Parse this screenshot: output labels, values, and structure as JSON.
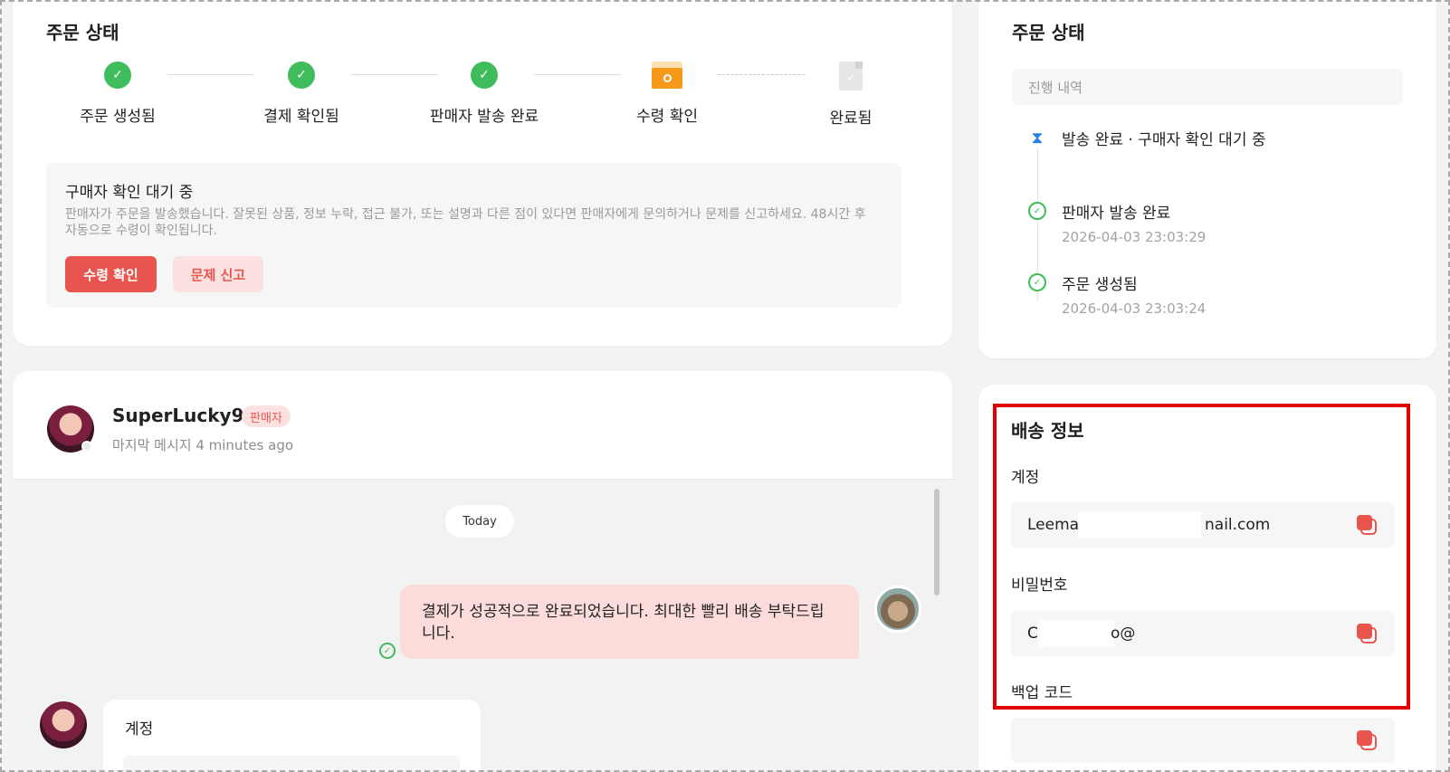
{
  "order_status": {
    "title": "주문 상태",
    "steps": [
      {
        "label": "주문 생성됨",
        "state": "done"
      },
      {
        "label": "결제 확인됨",
        "state": "done"
      },
      {
        "label": "판매자 발송 완료",
        "state": "done"
      },
      {
        "label": "수령 확인",
        "state": "current"
      },
      {
        "label": "완료됨",
        "state": "pending"
      }
    ],
    "notice": {
      "title": "구매자 확인 대기 중",
      "description": "판매자가 주문을 발송했습니다. 잘못된 상품, 정보 누락, 접근 불가, 또는 설명과 다른 점이 있다면 판매자에게 문의하거나 문제를 신고하세요. 48시간 후 자동으로 수령이 확인됩니다.",
      "confirm_button": "수령 확인",
      "report_button": "문제 신고"
    }
  },
  "chat": {
    "seller_name": "SuperLucky99",
    "seller_badge": "판매자",
    "last_message": "마지막 메시지 4 minutes ago",
    "date_divider": "Today",
    "messages": [
      {
        "direction": "out",
        "text": "결제가 성공적으로 완료되었습니다. 최대한 빨리 배송 부탁드립니다.",
        "read": true
      },
      {
        "direction": "in",
        "text": "계정"
      }
    ]
  },
  "progress": {
    "title": "주문 상태",
    "history_label": "진행 내역",
    "timeline": [
      {
        "text": "발송 완료 · 구매자 확인 대기 중",
        "time": "",
        "icon": "hourglass-icon"
      },
      {
        "text": "판매자 발송 완료",
        "time": "2026-04-03 23:03:29",
        "icon": "check-circle-icon"
      },
      {
        "text": "주문 생성됨",
        "time": "2026-04-03 23:03:24",
        "icon": "check-circle-icon"
      }
    ]
  },
  "shipping": {
    "title": "배송 정보",
    "account_label": "계정",
    "account_value_start": "Leema",
    "account_value_end": "nail.com",
    "password_label": "비밀번호",
    "password_value_start": "C",
    "password_value_end": "o@",
    "backup_label": "백업 코드",
    "backup_value": ""
  },
  "colors": {
    "accent": "#e8554f",
    "accent_soft": "#fbe2e1",
    "success": "#3fbd5c",
    "highlight_border": "#e00000",
    "info": "#2f7fe0"
  }
}
